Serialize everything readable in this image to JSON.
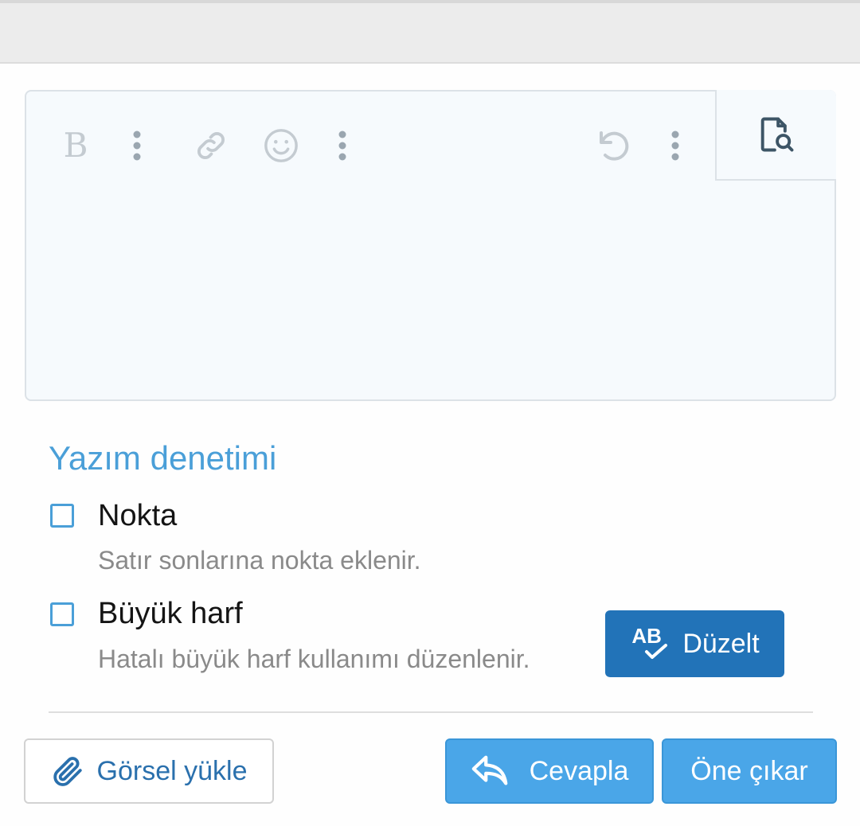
{
  "toolbar": {
    "icons": [
      "bold-icon",
      "more-vertical-icon",
      "link-icon",
      "emoji-icon",
      "more-vertical-icon",
      "undo-icon",
      "more-vertical-icon",
      "preview-icon"
    ],
    "bold_label": "B"
  },
  "spellcheck": {
    "title": "Yazım denetimi",
    "options": [
      {
        "label": "Nokta",
        "description": "Satır sonlarına nokta eklenir.",
        "checked": false
      },
      {
        "label": "Büyük harf",
        "description": "Hatalı büyük harf kullanımı düzenlenir.",
        "checked": false
      }
    ],
    "fix_button": {
      "icon_text": "AB",
      "label": "Düzelt"
    }
  },
  "actions": {
    "upload_label": "Görsel yükle",
    "reply_label": "Cevapla",
    "feature_label": "Öne çıkar"
  },
  "colors": {
    "accent": "#4a9fd8",
    "primary_button": "#4aa6e8",
    "fix_button": "#2273b8",
    "icon_gray": "#9aa6b0"
  }
}
